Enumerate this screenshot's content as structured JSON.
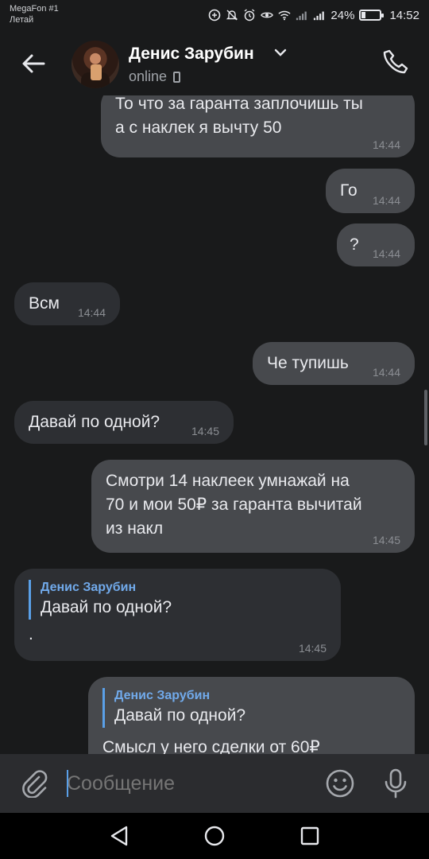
{
  "status_bar": {
    "carrier_line1": "MegaFon #1",
    "carrier_line2": "Летай",
    "battery_percent": "24%",
    "battery_level": 0.24,
    "time": "14:52"
  },
  "header": {
    "contact_name": "Денис Зарубин",
    "status": "online"
  },
  "messages": [
    {
      "direction": "out",
      "text_lines": [
        "То что за гаранта заплочишь ты",
        "а с наклек я вычту 50"
      ],
      "time": "14:44"
    },
    {
      "direction": "out",
      "text": "Го",
      "time": "14:44"
    },
    {
      "direction": "out",
      "text": "?",
      "time": "14:44"
    },
    {
      "direction": "in",
      "text": "Всм",
      "time": "14:44"
    },
    {
      "direction": "out",
      "text": "Че тупишь",
      "time": "14:44"
    },
    {
      "direction": "in",
      "text": "Давай по одной?",
      "time": "14:45"
    },
    {
      "direction": "out",
      "text_lines": [
        "Смотри 14 наклеек умнажай на",
        "70 и мои 50₽ за гаранта вычитай",
        "из накл"
      ],
      "time": "14:45"
    },
    {
      "direction": "in",
      "reply_name": "Денис Зарубин",
      "reply_text": "Давай по одной?",
      "text": ".",
      "time": "14:45"
    },
    {
      "direction": "out",
      "reply_name": "Денис Зарубин",
      "reply_text": "Давай по одной?",
      "text": "Смысл у него сделки от 60₽"
    }
  ],
  "composer": {
    "placeholder": "Сообщение"
  },
  "icons": {
    "back": "arrow-left-icon",
    "call": "phone-icon",
    "attach": "paperclip-icon",
    "emoji": "smiley-icon",
    "mic": "microphone-icon",
    "nav_back": "triangle-back-icon",
    "nav_home": "circle-home-icon",
    "nav_recent": "square-recent-icon"
  },
  "colors": {
    "background": "#191a1b",
    "bubble_out": "#47494d",
    "bubble_in": "#2d2f33",
    "accent": "#71aaeb"
  }
}
